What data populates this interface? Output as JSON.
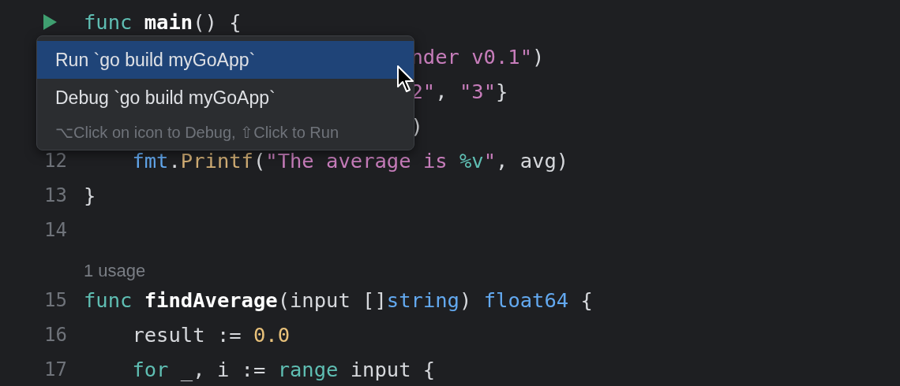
{
  "editor": {
    "lines": [
      {
        "kind": "run",
        "tokens": [
          {
            "t": "func ",
            "kind": "kw"
          },
          {
            "t": "main",
            "kind": "fn"
          },
          {
            "t": "() {",
            "kind": "plain"
          }
        ]
      },
      {
        "kind": "covered",
        "tokens": [
          {
            "t": "nder v0.1\"",
            "kind": "str"
          },
          {
            "t": ")",
            "kind": "plain"
          }
        ]
      },
      {
        "kind": "covered",
        "tokens": [
          {
            "t": "2\"",
            "kind": "str"
          },
          {
            "t": ", ",
            "kind": "plain"
          },
          {
            "t": "\"3\"",
            "kind": "str"
          },
          {
            "t": "}",
            "kind": "plain"
          }
        ]
      },
      {
        "kind": "covered",
        "tokens": [
          {
            "t": ")",
            "kind": "plain"
          }
        ]
      },
      {
        "kind": "code",
        "number": "12",
        "tokens": [
          {
            "t": "    fmt",
            "kind": "pkg"
          },
          {
            "t": ".",
            "kind": "plain"
          },
          {
            "t": "Printf",
            "kind": "call"
          },
          {
            "t": "(",
            "kind": "plain"
          },
          {
            "t": "\"The average is ",
            "kind": "str"
          },
          {
            "t": "%v",
            "kind": "esc"
          },
          {
            "t": "\"",
            "kind": "str"
          },
          {
            "t": ", avg)",
            "kind": "plain"
          }
        ]
      },
      {
        "kind": "code",
        "number": "13",
        "tokens": [
          {
            "t": "}",
            "kind": "plain"
          }
        ]
      },
      {
        "kind": "code",
        "number": "14"
      },
      {
        "kind": "hint",
        "text": "1 usage"
      },
      {
        "kind": "code",
        "number": "15",
        "tokens": [
          {
            "t": "func ",
            "kind": "kw"
          },
          {
            "t": "findAverage",
            "kind": "fn"
          },
          {
            "t": "(input []",
            "kind": "plain"
          },
          {
            "t": "string",
            "kind": "type"
          },
          {
            "t": ") ",
            "kind": "plain"
          },
          {
            "t": "float64",
            "kind": "type"
          },
          {
            "t": " {",
            "kind": "plain"
          }
        ]
      },
      {
        "kind": "code",
        "number": "16",
        "tokens": [
          {
            "t": "    result := ",
            "kind": "plain"
          },
          {
            "t": "0.0",
            "kind": "num"
          }
        ]
      },
      {
        "kind": "code",
        "number": "17",
        "tokens": [
          {
            "t": "    for",
            "kind": "kw"
          },
          {
            "t": " _, i := ",
            "kind": "plain"
          },
          {
            "t": "range",
            "kind": "kw"
          },
          {
            "t": " input {",
            "kind": "plain"
          }
        ]
      }
    ]
  },
  "popup": {
    "items": [
      {
        "label": "Run `go build myGoApp`",
        "selected": true
      },
      {
        "label": "Debug `go build myGoApp`",
        "selected": false
      }
    ],
    "hint": "⌥Click on icon to Debug, ⇧Click to Run"
  }
}
